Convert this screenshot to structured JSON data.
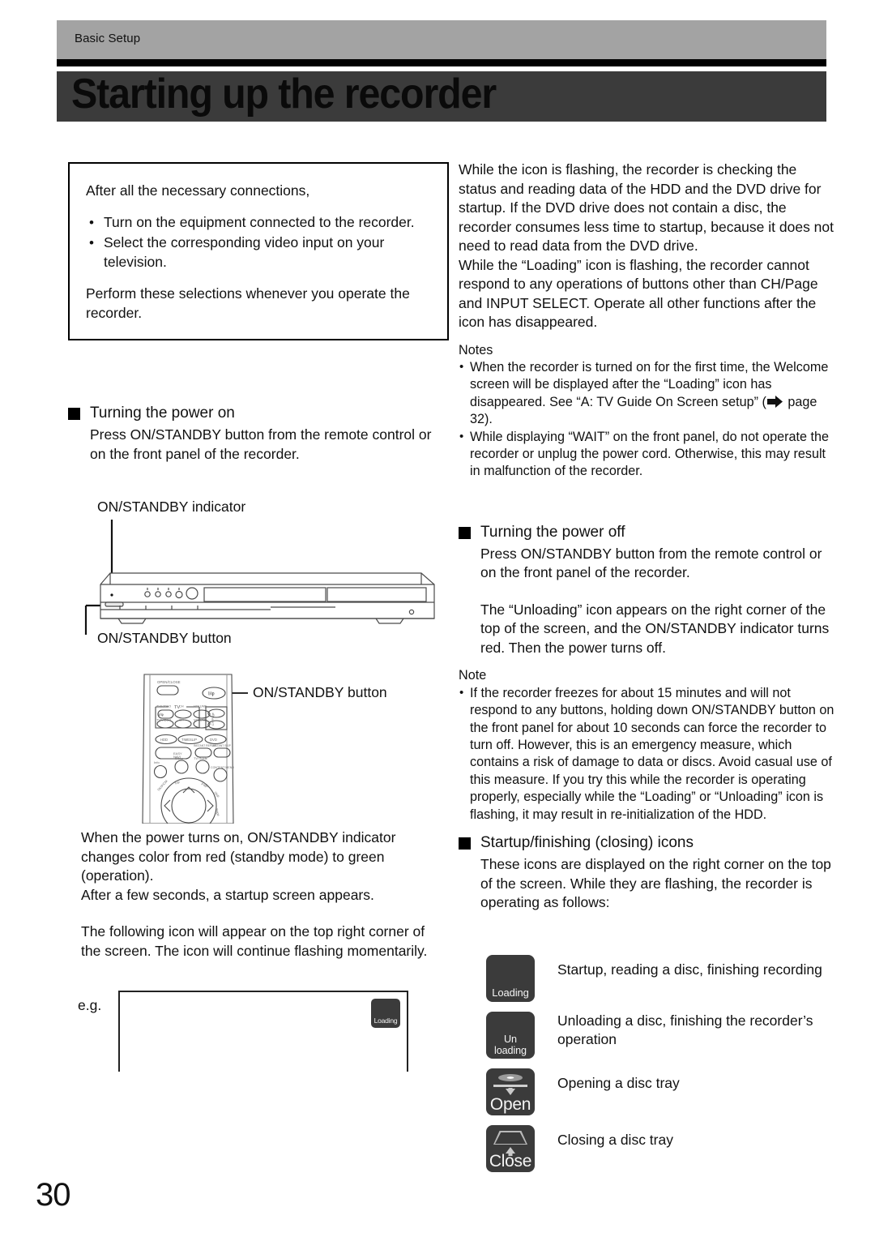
{
  "header": {
    "breadcrumb": "Basic Setup",
    "title": "Starting up the recorder",
    "band_color": "#a3a3a3",
    "title_band_color": "#3b3b3b"
  },
  "left_column": {
    "intro_box": {
      "lead": "After all the necessary connections,",
      "bullets": [
        "Turn on the equipment connected to the recorder.",
        "Select the corresponding video input on your television."
      ],
      "tail": "Perform these selections whenever you operate the recorder."
    },
    "power_on": {
      "heading": "Turning the power on",
      "body": "Press ON/STANDBY button from the remote control or on the front panel of the recorder."
    },
    "front_panel_labels": {
      "indicator": "ON/STANDBY indicator",
      "button": "ON/STANDBY button"
    },
    "remote_label": "ON/STANDBY button",
    "after_power_on": "When the power turns on, ON/STANDBY indicator changes color from red (standby mode) to green (operation).\nAfter a few seconds, a startup screen appears.",
    "icon_intro": "The following icon will appear on the top right corner of the screen. The icon will continue flashing momentarily.",
    "example": {
      "label": "e.g.",
      "screen_icon_text": "Loading"
    }
  },
  "right_column": {
    "flashing_paragraph_1": "While the icon is flashing, the recorder is checking the status and reading data of the HDD and the DVD drive for startup. If the DVD drive does not contain a disc, the recorder consumes less time to startup, because it does not need to read data from the DVD drive.",
    "flashing_paragraph_2": "While the “Loading” icon is flashing, the recorder cannot respond to any operations of buttons other than CH/Page and INPUT SELECT. Operate all other functions after the icon has disappeared.",
    "notes_heading": "Notes",
    "notes": [
      {
        "before_arrow": "When the recorder is turned on for the first time, the Welcome screen will be displayed after the “Loading” icon has disappeared. See “A: TV Guide On Screen setup” (",
        "after_arrow": " page 32)."
      },
      {
        "text": "While displaying “WAIT” on the front panel, do not operate the recorder or unplug the power cord. Otherwise, this may result in malfunction of the recorder."
      }
    ],
    "power_off": {
      "heading": "Turning the power off",
      "body_1": "Press ON/STANDBY button from the remote control or on the front panel of the recorder.",
      "body_2": "The “Unloading” icon appears on the right corner of the top of the screen, and the ON/STANDBY indicator turns red. Then the power turns off."
    },
    "note_heading": "Note",
    "note_text": "If the recorder freezes for about 15 minutes and will not respond to any buttons, holding down ON/STANDBY button on the front panel for about 10 seconds can force the recorder to turn off. However, this is an emergency measure, which contains a risk of damage to data or discs. Avoid casual use of this measure. If you try this while the recorder is operating properly, especially while the “Loading” or “Unloading” icon is flashing, it may result in re-initialization of the HDD.",
    "startup_icons": {
      "heading": "Startup/finishing (closing) icons",
      "body": "These icons are displayed on the right corner on the top of the screen. While they are flashing, the recorder is operating as follows:",
      "items": [
        {
          "tile_text": "Loading",
          "tile_text_2": "",
          "description": "Startup, reading a disc, finishing recording"
        },
        {
          "tile_text": "Un",
          "tile_text_2": "loading",
          "description": "Unloading a disc, finishing the recorder’s operation"
        },
        {
          "tile_text": "Open",
          "tile_text_2": "",
          "description": "Opening a disc tray"
        },
        {
          "tile_text": "Close",
          "tile_text_2": "",
          "description": "Closing a disc tray"
        }
      ]
    }
  },
  "remote_buttons": {
    "open_close": "OPEN/CLOSE",
    "power": "I/φ",
    "tv": "TV",
    "tv_video": "TV/VIDEO",
    "ch": "CH",
    "volume": "VOLUME",
    "ch_page": "CH/Page",
    "hdd": "HDD",
    "timeslip": "TIMESLIP",
    "dvd": "DVD",
    "easy_navi": "EASY NAVI",
    "instant_replay": "INSTANT REPLAY",
    "instant_skip": "INSTANT SKIP",
    "info": "Info",
    "menu": "Menu",
    "tv_guide": "TV Guide",
    "content_menu": "CONTENT MENU"
  },
  "footer": {
    "page_number": "30"
  }
}
